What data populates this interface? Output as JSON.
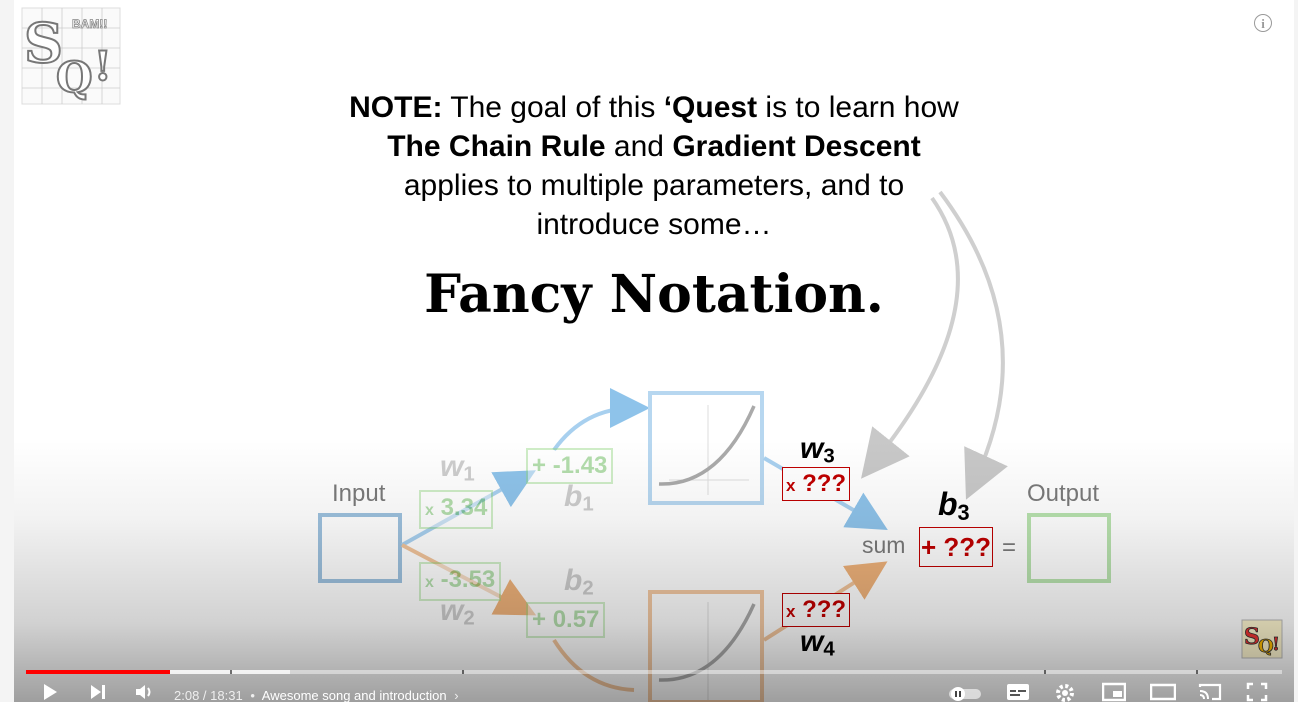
{
  "slide": {
    "note": {
      "lead": "NOTE:",
      "t1": " The goal of this ",
      "b1": "‘Quest",
      "t2": " is to learn how ",
      "b2": "The Chain Rule",
      "t3": " and ",
      "b3": "Gradient Descent",
      "t4": " applies to multiple parameters, and to introduce some…"
    },
    "fancy": "Fancy Notation.",
    "diagram": {
      "input_label": "Input",
      "output_label": "Output",
      "w1_value": "3.34",
      "w2_value": "-3.53",
      "b1_value": "-1.43",
      "b2_value": "0.57",
      "w3_value": "???",
      "w4_value": "???",
      "b3_value": "???",
      "sum_label": "sum",
      "equals": "=",
      "mult_sign": "x",
      "plus_sign": "+",
      "w_letter": "w",
      "b_letter": "b",
      "idx1": "1",
      "idx2": "2",
      "idx3": "3",
      "idx4": "4"
    }
  },
  "logo_text": {
    "s": "S",
    "q": "Q",
    "bang": "!",
    "bam": "BAM!!"
  },
  "player": {
    "current_time": "2:08",
    "separator": " / ",
    "duration": "18:31",
    "bullet": "•",
    "chapter": "Awesome song and introduction",
    "chapter_arrow": "›",
    "progress_fraction": 0.115,
    "buffer_fraction": 0.21,
    "accent_color": "#ff0000",
    "icons": [
      "play-icon",
      "next-icon",
      "volume-icon",
      "autoplay-toggle-icon",
      "subtitles-icon",
      "settings-icon",
      "miniplayer-icon",
      "theater-icon",
      "cast-icon",
      "fullscreen-icon",
      "info-icon"
    ]
  }
}
